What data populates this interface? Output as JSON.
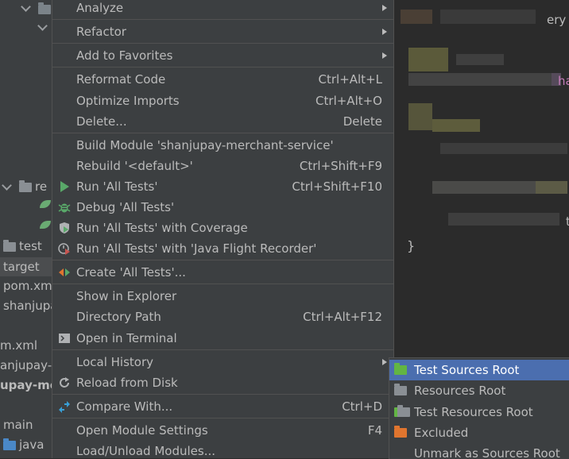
{
  "project_tree": {
    "items": [
      {
        "label": "re",
        "type": "folder"
      },
      {
        "label": "test",
        "type": "folder"
      },
      {
        "label": "target",
        "type": "folder",
        "selected": true
      },
      {
        "label": "pom.xm",
        "type": "file"
      },
      {
        "label": "shanjupa",
        "type": "file"
      },
      {
        "label": "m.xml",
        "type": "file"
      },
      {
        "label": "anjupay-r",
        "type": "module"
      },
      {
        "label": "upay-me",
        "type": "module",
        "bold": true
      },
      {
        "label": "main",
        "type": "folder"
      },
      {
        "label": "java",
        "type": "folder"
      }
    ]
  },
  "context_menu": {
    "items": [
      {
        "label": "Analyze",
        "submenu": true
      },
      {
        "label": "Refactor",
        "submenu": true
      },
      {
        "label": "Add to Favorites",
        "submenu": true
      },
      {
        "label": "Reformat Code",
        "shortcut": "Ctrl+Alt+L"
      },
      {
        "label": "Optimize Imports",
        "shortcut": "Ctrl+Alt+O"
      },
      {
        "label": "Delete...",
        "shortcut": "Delete"
      },
      {
        "label": "Build Module 'shanjupay-merchant-service'"
      },
      {
        "label": "Rebuild '<default>'",
        "shortcut": "Ctrl+Shift+F9"
      },
      {
        "label": "Run 'All Tests'",
        "shortcut": "Ctrl+Shift+F10",
        "icon": "run-icon"
      },
      {
        "label": "Debug 'All Tests'",
        "icon": "debug-icon"
      },
      {
        "label": "Run 'All Tests' with Coverage",
        "icon": "coverage-icon"
      },
      {
        "label": "Run 'All Tests' with 'Java Flight Recorder'",
        "icon": "profiler-icon"
      },
      {
        "label": "Create 'All Tests'...",
        "icon": "create-config-icon"
      },
      {
        "label": "Show in Explorer"
      },
      {
        "label": "Directory Path",
        "shortcut": "Ctrl+Alt+F12"
      },
      {
        "label": "Open in Terminal",
        "icon": "terminal-icon"
      },
      {
        "label": "Local History",
        "submenu": true
      },
      {
        "label": "Reload from Disk",
        "icon": "reload-icon"
      },
      {
        "label": "Compare With...",
        "shortcut": "Ctrl+D",
        "icon": "compare-icon"
      },
      {
        "label": "Open Module Settings",
        "shortcut": "F4"
      },
      {
        "label": "Load/Unload Modules..."
      }
    ]
  },
  "mark_directory_submenu": {
    "items": [
      {
        "label": "Test Sources Root",
        "icon": "test-sources-folder-icon",
        "selected": true
      },
      {
        "label": "Resources Root",
        "icon": "resources-folder-icon"
      },
      {
        "label": "Test Resources Root",
        "icon": "test-resources-folder-icon"
      },
      {
        "label": "Excluded",
        "icon": "excluded-folder-icon"
      },
      {
        "label": "Unmark as Sources Root"
      }
    ]
  },
  "editor": {
    "brace": "}",
    "frag_top": "ery",
    "frag_mid": "ha",
    "frag_low": "t"
  },
  "colors": {
    "menu_bg": "#3c3f41",
    "selection": "#4b6eaf",
    "run_green": "#59a869",
    "test_folder_green": "#62b543",
    "excluded_orange": "#e0752f"
  }
}
